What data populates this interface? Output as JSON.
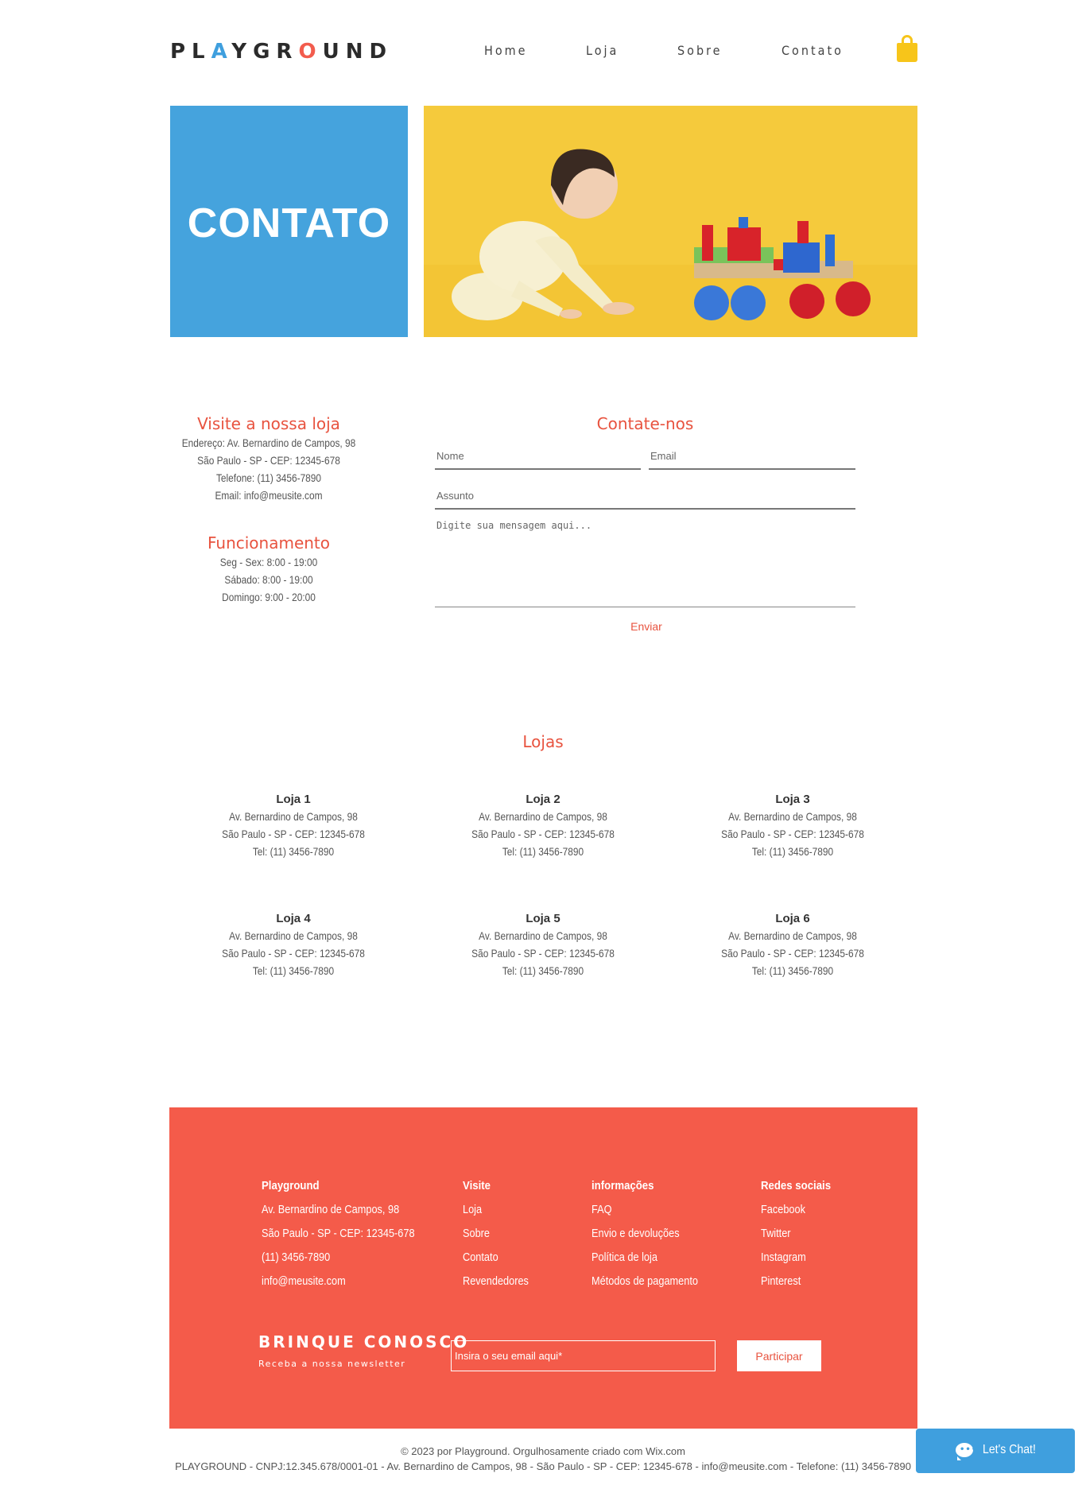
{
  "header": {
    "logo": {
      "p1": "PL",
      "a": "A",
      "p2": "YGR",
      "o": "O",
      "p3": "UND"
    },
    "nav": [
      "Home",
      "Loja",
      "Sobre",
      "Contato"
    ]
  },
  "hero": {
    "title": "CONTATO"
  },
  "visit": {
    "title": "Visite a nossa loja",
    "lines": [
      "Endereço: Av. Bernardino de Campos, 98",
      "São Paulo - SP - CEP: 12345-678",
      "Telefone: (11) 3456-7890",
      "Email: info@meusite.com"
    ]
  },
  "hours": {
    "title": "Funcionamento",
    "lines": [
      "Seg - Sex: 8:00 - 19:00",
      "Sábado: 8:00 - 19:00",
      "Domingo: 9:00 - 20:00"
    ]
  },
  "form": {
    "title": "Contate-nos",
    "name_placeholder": "Nome",
    "email_placeholder": "Email",
    "subject_placeholder": "Assunto",
    "message_placeholder": "Digite sua mensagem aqui...",
    "submit": "Enviar"
  },
  "stores": {
    "title": "Lojas",
    "items": [
      {
        "name": "Loja 1",
        "address": "Av. Bernardino de Campos, 98",
        "city": "São Paulo - SP - CEP: 12345-678",
        "phone": "Tel: (11) 3456-7890"
      },
      {
        "name": "Loja 2",
        "address": "Av. Bernardino de Campos, 98",
        "city": "São Paulo - SP - CEP: 12345-678",
        "phone": "Tel: (11) 3456-7890"
      },
      {
        "name": "Loja 3",
        "address": "Av. Bernardino de Campos, 98",
        "city": "São Paulo - SP - CEP: 12345-678",
        "phone": "Tel: (11) 3456-7890"
      },
      {
        "name": "Loja 4",
        "address": "Av. Bernardino de Campos, 98",
        "city": "São Paulo - SP - CEP: 12345-678",
        "phone": "Tel: (11) 3456-7890"
      },
      {
        "name": "Loja 5",
        "address": "Av. Bernardino de Campos, 98",
        "city": "São Paulo - SP - CEP: 12345-678",
        "phone": "Tel: (11) 3456-7890"
      },
      {
        "name": "Loja 6",
        "address": "Av. Bernardino de Campos, 98",
        "city": "São Paulo - SP - CEP: 12345-678",
        "phone": "Tel: (11) 3456-7890"
      }
    ]
  },
  "footer": {
    "company": {
      "title": "Playground",
      "lines": [
        "Av. Bernardino de Campos, 98",
        "São Paulo - SP - CEP: 12345-678",
        "(11) 3456-7890",
        "info@meusite.com"
      ]
    },
    "visit": {
      "title": "Visite",
      "links": [
        "Loja",
        "Sobre",
        "Contato",
        "Revendedores"
      ]
    },
    "info": {
      "title": "informações",
      "links": [
        "FAQ",
        "Envio e devoluções",
        "Política de loja",
        "Métodos de pagamento"
      ]
    },
    "social": {
      "title": "Redes sociais",
      "links": [
        "Facebook",
        "Twitter",
        "Instagram",
        "Pinterest"
      ]
    },
    "newsletter": {
      "title": "BRINQUE CONOSCO",
      "subtitle": "Receba a nossa newsletter",
      "placeholder": "Insira o seu email aqui*",
      "button": "Participar"
    }
  },
  "copyright": {
    "line1": "© 2023 por Playground. Orgulhosamente criado com Wix.com",
    "line2": "PLAYGROUND - CNPJ:12.345.678/0001-01 - Av. Bernardino de Campos, 98 - São Paulo - SP - CEP: 12345-678 - info@meusite.com - Telefone: (11) 3456-7890"
  },
  "chat": {
    "label": "Let's Chat!"
  },
  "colors": {
    "accent_red": "#f45b4a",
    "accent_blue": "#45a3dd",
    "cart_yellow": "#f7c51a"
  }
}
